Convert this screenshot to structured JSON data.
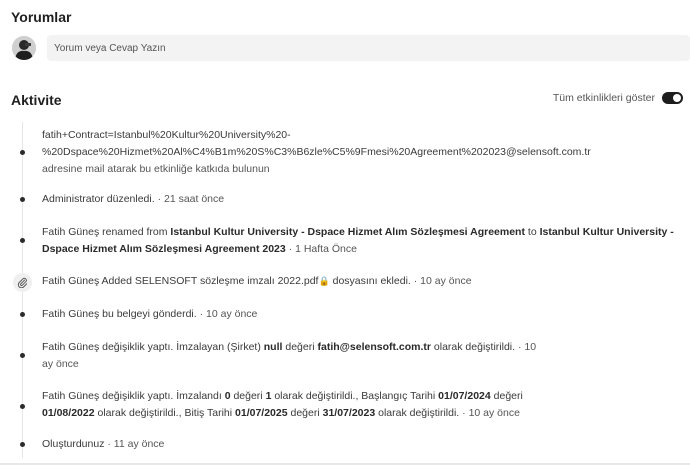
{
  "comments": {
    "title": "Yorumlar",
    "placeholder": "Yorum veya Cevap Yazın"
  },
  "activity": {
    "title": "Aktivite",
    "toggle_label": "Tüm etkinlikleri göster",
    "toggle_on": true,
    "events": [
      {
        "line1": "fatih+Contract=Istanbul%20Kultur%20University%20-",
        "line2": "%20Dspace%20Hizmet%20Al%C4%B1m%20S%C3%B6zle%C5%9Fmesi%20Agreement%202023@selensoft.com.tr",
        "line3": "adresine mail atarak bu etkinliğe katkıda bulunun"
      },
      {
        "text": "Administrator düzenledi.",
        "time": "· 21 saat önce"
      },
      {
        "actor": "Fatih Güneş",
        "action": "renamed from",
        "from": "Istanbul Kultur University - Dspace Hizmet Alım Sözleşmesi Agreement",
        "to_word": "to",
        "to": "Istanbul Kultur University - Dspace Hizmet Alım Sözleşmesi Agreement 2023",
        "time": "· 1 Hafta Önce"
      },
      {
        "actor": "Fatih Güneş",
        "action": "Added SELENSOFT sözleşme imzalı 2022.pdf",
        "suffix": "dosyasını ekledi.",
        "time": "· 10 ay önce"
      },
      {
        "text": "Fatih Güneş bu belgeyi gönderdi.",
        "time": "· 10 ay önce"
      },
      {
        "prefix": "Fatih Güneş değişiklik yaptı. İmzalayan (Şirket)",
        "old": "null",
        "mid": "değeri",
        "new": "fatih@selensoft.com.tr",
        "suffix": "olarak değiştirildi.",
        "time_a": "· 10",
        "time_b": "ay önce"
      },
      {
        "p1": "Fatih Güneş değişiklik yaptı. İmzalandı",
        "v1": "0",
        "p2": "değeri",
        "v2": "1",
        "p3": "olarak değiştirildi., Başlangıç Tarihi",
        "v3": "01/07/2024",
        "p4": "değeri",
        "v4": "01/08/2022",
        "p5": "olarak değiştirildi., Bitiş Tarihi",
        "v5": "01/07/2025",
        "p6": "değeri",
        "v6": "31/07/2023",
        "p7": "olarak değiştirildi.",
        "time": "· 10 ay önce"
      },
      {
        "text": "Oluşturdunuz",
        "time": "· 11 ay önce"
      }
    ]
  },
  "icons": {
    "avatar": "user-avatar",
    "attachment": "paperclip-icon",
    "lock": "lock-icon"
  }
}
